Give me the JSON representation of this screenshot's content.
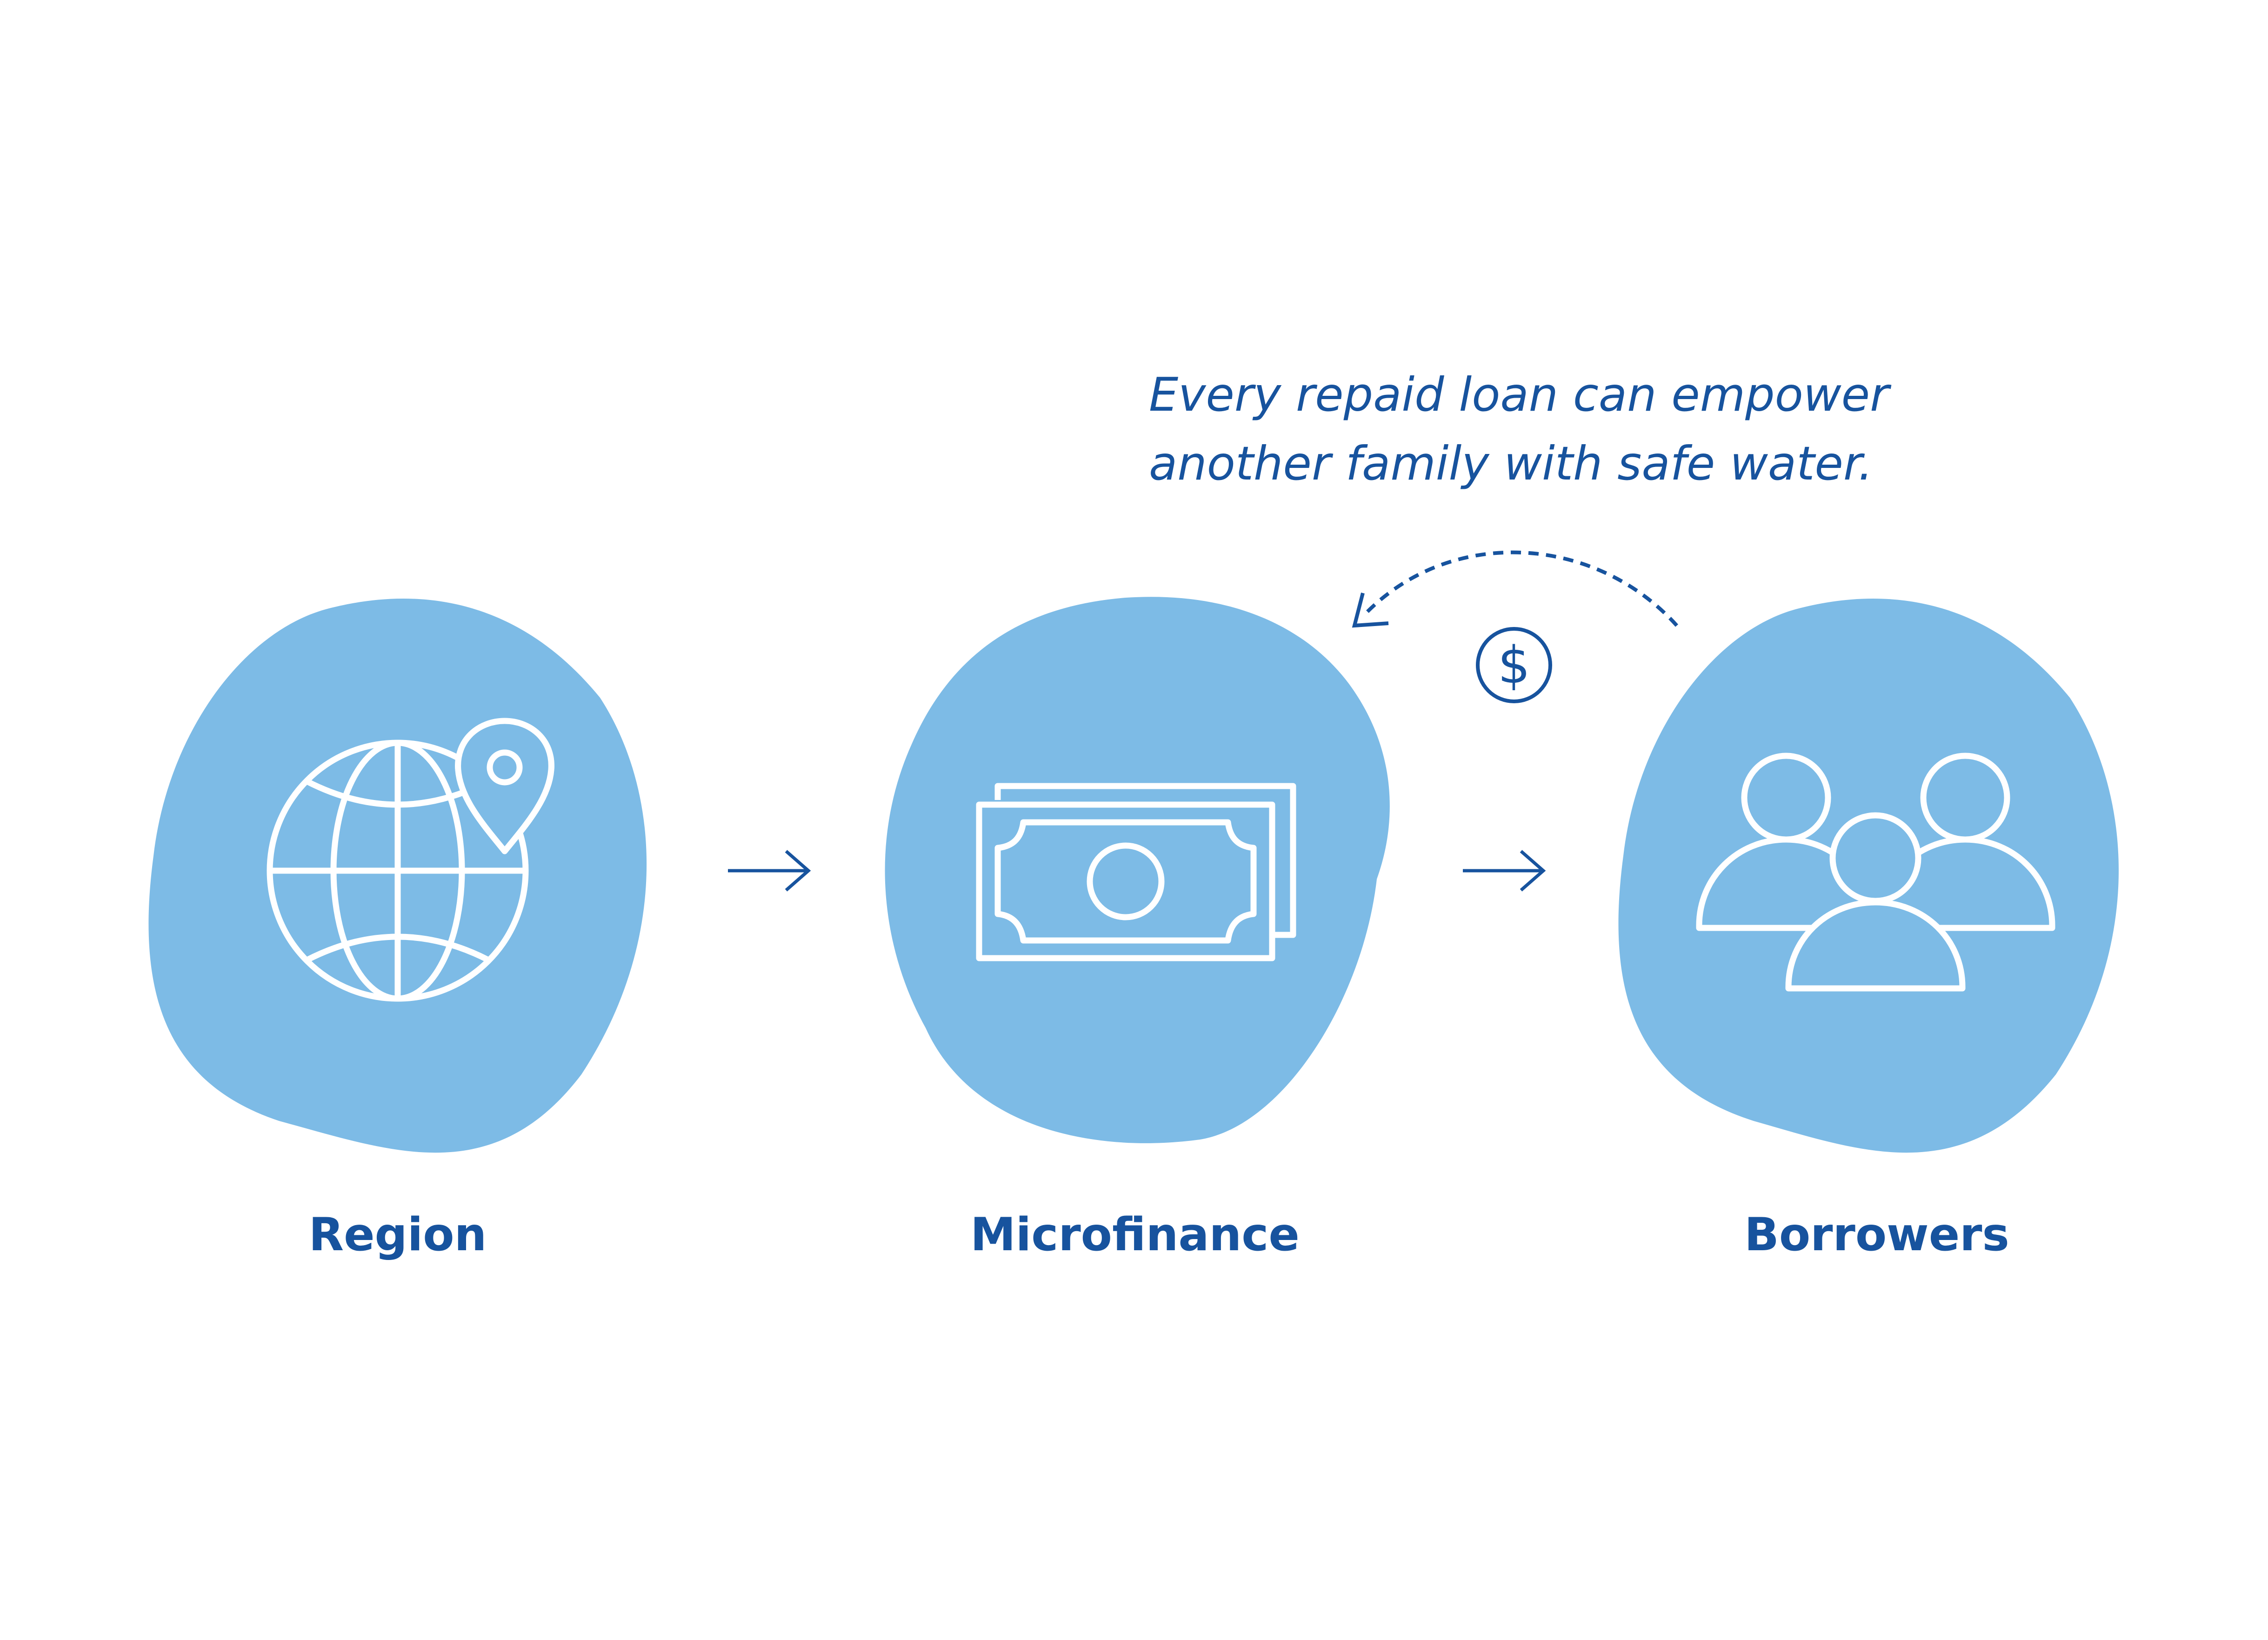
{
  "caption": {
    "line1": "Every repaid loan can empower",
    "line2": "another family with safe water."
  },
  "nodes": [
    {
      "label": "Region",
      "icon": "globe-location-icon"
    },
    {
      "label": "Microfinance",
      "icon": "banknotes-icon"
    },
    {
      "label": "Borrowers",
      "icon": "people-group-icon"
    }
  ],
  "repayment_icon": "dollar-coin-icon",
  "colors": {
    "blob": "#7dbbe6",
    "accent": "#17539e",
    "icon_stroke": "#ffffff",
    "background": "#ffffff"
  }
}
